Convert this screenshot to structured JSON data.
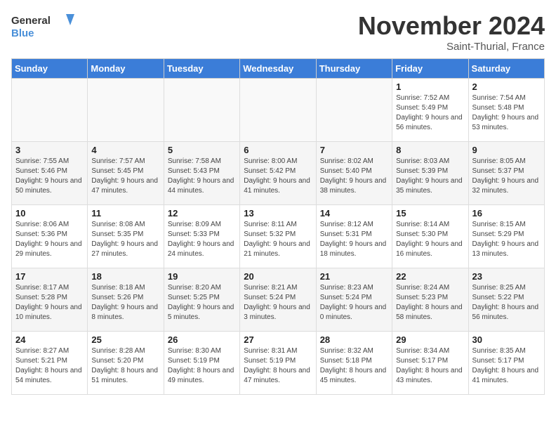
{
  "header": {
    "logo_line1": "General",
    "logo_line2": "Blue",
    "month_title": "November 2024",
    "location": "Saint-Thurial, France"
  },
  "days_of_week": [
    "Sunday",
    "Monday",
    "Tuesday",
    "Wednesday",
    "Thursday",
    "Friday",
    "Saturday"
  ],
  "weeks": [
    [
      {
        "day": "",
        "info": ""
      },
      {
        "day": "",
        "info": ""
      },
      {
        "day": "",
        "info": ""
      },
      {
        "day": "",
        "info": ""
      },
      {
        "day": "",
        "info": ""
      },
      {
        "day": "1",
        "info": "Sunrise: 7:52 AM\nSunset: 5:49 PM\nDaylight: 9 hours and 56 minutes."
      },
      {
        "day": "2",
        "info": "Sunrise: 7:54 AM\nSunset: 5:48 PM\nDaylight: 9 hours and 53 minutes."
      }
    ],
    [
      {
        "day": "3",
        "info": "Sunrise: 7:55 AM\nSunset: 5:46 PM\nDaylight: 9 hours and 50 minutes."
      },
      {
        "day": "4",
        "info": "Sunrise: 7:57 AM\nSunset: 5:45 PM\nDaylight: 9 hours and 47 minutes."
      },
      {
        "day": "5",
        "info": "Sunrise: 7:58 AM\nSunset: 5:43 PM\nDaylight: 9 hours and 44 minutes."
      },
      {
        "day": "6",
        "info": "Sunrise: 8:00 AM\nSunset: 5:42 PM\nDaylight: 9 hours and 41 minutes."
      },
      {
        "day": "7",
        "info": "Sunrise: 8:02 AM\nSunset: 5:40 PM\nDaylight: 9 hours and 38 minutes."
      },
      {
        "day": "8",
        "info": "Sunrise: 8:03 AM\nSunset: 5:39 PM\nDaylight: 9 hours and 35 minutes."
      },
      {
        "day": "9",
        "info": "Sunrise: 8:05 AM\nSunset: 5:37 PM\nDaylight: 9 hours and 32 minutes."
      }
    ],
    [
      {
        "day": "10",
        "info": "Sunrise: 8:06 AM\nSunset: 5:36 PM\nDaylight: 9 hours and 29 minutes."
      },
      {
        "day": "11",
        "info": "Sunrise: 8:08 AM\nSunset: 5:35 PM\nDaylight: 9 hours and 27 minutes."
      },
      {
        "day": "12",
        "info": "Sunrise: 8:09 AM\nSunset: 5:33 PM\nDaylight: 9 hours and 24 minutes."
      },
      {
        "day": "13",
        "info": "Sunrise: 8:11 AM\nSunset: 5:32 PM\nDaylight: 9 hours and 21 minutes."
      },
      {
        "day": "14",
        "info": "Sunrise: 8:12 AM\nSunset: 5:31 PM\nDaylight: 9 hours and 18 minutes."
      },
      {
        "day": "15",
        "info": "Sunrise: 8:14 AM\nSunset: 5:30 PM\nDaylight: 9 hours and 16 minutes."
      },
      {
        "day": "16",
        "info": "Sunrise: 8:15 AM\nSunset: 5:29 PM\nDaylight: 9 hours and 13 minutes."
      }
    ],
    [
      {
        "day": "17",
        "info": "Sunrise: 8:17 AM\nSunset: 5:28 PM\nDaylight: 9 hours and 10 minutes."
      },
      {
        "day": "18",
        "info": "Sunrise: 8:18 AM\nSunset: 5:26 PM\nDaylight: 9 hours and 8 minutes."
      },
      {
        "day": "19",
        "info": "Sunrise: 8:20 AM\nSunset: 5:25 PM\nDaylight: 9 hours and 5 minutes."
      },
      {
        "day": "20",
        "info": "Sunrise: 8:21 AM\nSunset: 5:24 PM\nDaylight: 9 hours and 3 minutes."
      },
      {
        "day": "21",
        "info": "Sunrise: 8:23 AM\nSunset: 5:24 PM\nDaylight: 9 hours and 0 minutes."
      },
      {
        "day": "22",
        "info": "Sunrise: 8:24 AM\nSunset: 5:23 PM\nDaylight: 8 hours and 58 minutes."
      },
      {
        "day": "23",
        "info": "Sunrise: 8:25 AM\nSunset: 5:22 PM\nDaylight: 8 hours and 56 minutes."
      }
    ],
    [
      {
        "day": "24",
        "info": "Sunrise: 8:27 AM\nSunset: 5:21 PM\nDaylight: 8 hours and 54 minutes."
      },
      {
        "day": "25",
        "info": "Sunrise: 8:28 AM\nSunset: 5:20 PM\nDaylight: 8 hours and 51 minutes."
      },
      {
        "day": "26",
        "info": "Sunrise: 8:30 AM\nSunset: 5:19 PM\nDaylight: 8 hours and 49 minutes."
      },
      {
        "day": "27",
        "info": "Sunrise: 8:31 AM\nSunset: 5:19 PM\nDaylight: 8 hours and 47 minutes."
      },
      {
        "day": "28",
        "info": "Sunrise: 8:32 AM\nSunset: 5:18 PM\nDaylight: 8 hours and 45 minutes."
      },
      {
        "day": "29",
        "info": "Sunrise: 8:34 AM\nSunset: 5:17 PM\nDaylight: 8 hours and 43 minutes."
      },
      {
        "day": "30",
        "info": "Sunrise: 8:35 AM\nSunset: 5:17 PM\nDaylight: 8 hours and 41 minutes."
      }
    ]
  ]
}
